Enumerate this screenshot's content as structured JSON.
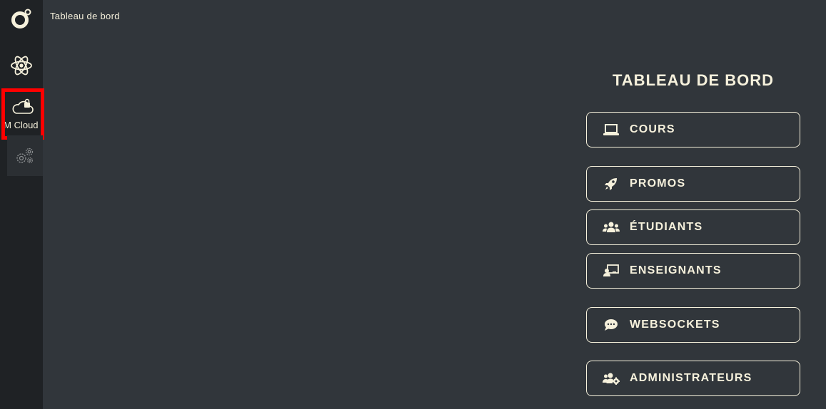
{
  "breadcrumb": "Tableau de bord",
  "sidebar": {
    "items": [
      {
        "id": "logo",
        "icon": "logo-icon"
      },
      {
        "id": "react",
        "icon": "atom-icon"
      },
      {
        "id": "vm-cloud",
        "icon": "cloud-lock-icon",
        "label": "VM Cloud",
        "highlighted": true
      },
      {
        "id": "settings",
        "icon": "gears-icon"
      }
    ]
  },
  "dashboard": {
    "title": "TABLEAU DE BORD",
    "buttons": [
      {
        "label": "COURS",
        "icon": "laptop-icon"
      },
      {
        "label": "PROMOS",
        "icon": "rocket-icon"
      },
      {
        "label": "ÉTUDIANTS",
        "icon": "users-icon"
      },
      {
        "label": "ENSEIGNANTS",
        "icon": "teacher-icon"
      },
      {
        "label": "WEBSOCKETS",
        "icon": "comment-icon"
      },
      {
        "label": "ADMINISTRATEURS",
        "icon": "users-cog-icon"
      }
    ]
  },
  "colors": {
    "background": "#31363b",
    "sidebar": "#1f2225",
    "text": "#f6f1dc",
    "highlight": "#ff0000"
  }
}
